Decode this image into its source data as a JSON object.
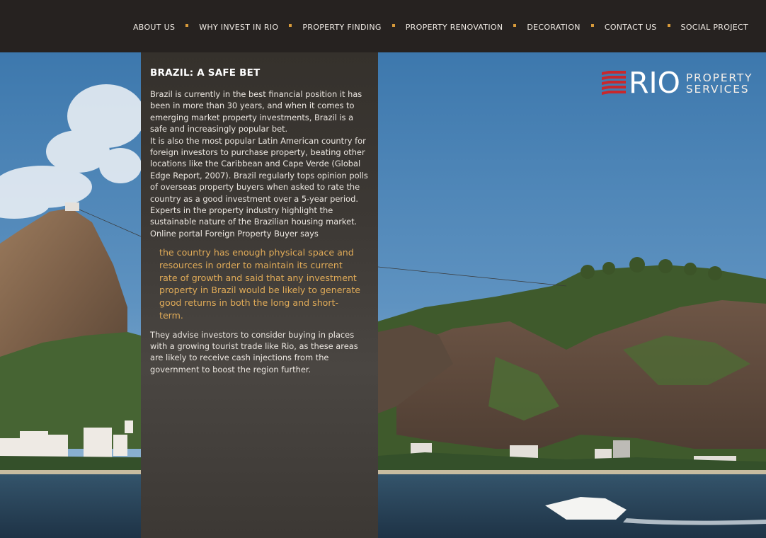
{
  "nav": {
    "items": [
      {
        "label": "ABOUT US"
      },
      {
        "label": "WHY INVEST IN RIO"
      },
      {
        "label": "PROPERTY FINDING"
      },
      {
        "label": "PROPERTY RENOVATION"
      },
      {
        "label": "DECORATION"
      },
      {
        "label": "CONTACT US"
      },
      {
        "label": "SOCIAL PROJECT"
      }
    ]
  },
  "logo": {
    "name": "RIO",
    "line1": "PROPERTY",
    "line2": "SERVICES",
    "icon": "rio-stripes-logo"
  },
  "article": {
    "title": "BRAZIL: A SAFE BET",
    "para1": "Brazil is currently in the best financial position it has been in more than 30 years, and when it comes to emerging market property investments, Brazil is a safe and increasingly popular bet.",
    "para2": "It is also the most popular Latin American country for foreign investors to purchase property, beating other locations like the Caribbean and Cape Verde (Global Edge Report, 2007). Brazil regularly tops opinion polls of overseas property buyers when asked to rate the country as a good investment over a 5-year period.",
    "para3": "Experts in the property industry highlight the sustainable nature of the Brazilian housing market. Online portal Foreign Property Buyer says",
    "quote": "the country has enough physical space and resources in order to maintain its current rate of growth and said that any investment property in Brazil would be likely to generate good returns in both the long and short-term.",
    "para4": "They advise investors to consider buying in places with a growing tourist trade like Rio, as these areas are likely to receive cash injections from the government to boost the region further."
  },
  "colors": {
    "accent": "#d79a3a",
    "quote": "#e0ab58",
    "logo_red": "#c8282c"
  }
}
